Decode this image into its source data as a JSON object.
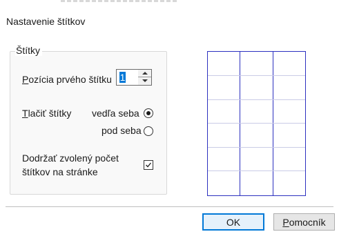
{
  "dialog": {
    "title": "Nastavenie štítkov"
  },
  "group": {
    "legend": "Štítky",
    "first_label_position": {
      "label": "Pozícia prvého štítku",
      "value": "1"
    },
    "print_labels": {
      "label": "Tlačiť štítky",
      "options": [
        {
          "label": "vedľa seba",
          "selected": true
        },
        {
          "label": "pod seba",
          "selected": false
        }
      ]
    },
    "keep_count": {
      "label_line1": "Dodržať zvolený počet",
      "label_line2": "štítkov na stránke",
      "checked": true
    }
  },
  "preview": {
    "columns": 3,
    "rows": 6
  },
  "buttons": {
    "ok": "OK",
    "help": "Pomocník"
  },
  "colors": {
    "preview_border": "#2b2fbf",
    "preview_row_line": "#c9cbe6",
    "focus_accent": "#0078d7"
  }
}
